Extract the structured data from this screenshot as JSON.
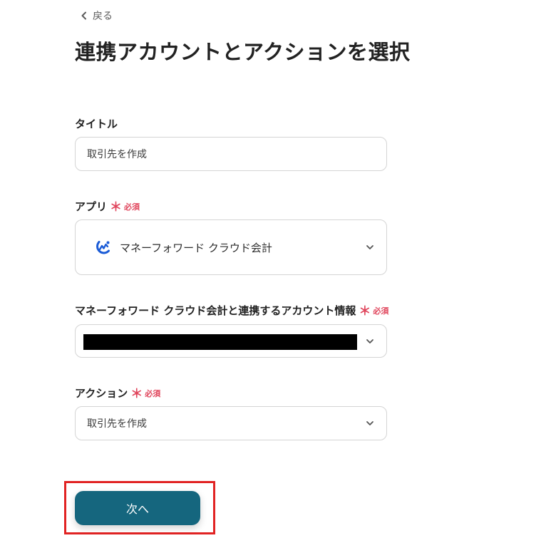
{
  "header": {
    "back_label": "戻る",
    "title": "連携アカウントとアクションを選択"
  },
  "form": {
    "title_field": {
      "label": "タイトル",
      "value": "取引先を作成"
    },
    "app_field": {
      "label": "アプリ",
      "required_mark": "＊",
      "required_text": "必須",
      "value": "マネーフォワード クラウド会計",
      "logo_icon": "moneyforward-logo-icon",
      "logo_color": "#1a5bd6"
    },
    "account_field": {
      "label": "マネーフォワード クラウド会計と連携するアカウント情報",
      "required_mark": "＊",
      "required_text": "必須"
    },
    "action_field": {
      "label": "アクション",
      "required_mark": "＊",
      "required_text": "必須",
      "value": "取引先を作成"
    }
  },
  "footer": {
    "next_label": "次へ",
    "button_color": "#15667e",
    "highlight_color": "#e12323"
  },
  "colors": {
    "required": "#e0455c",
    "border": "#d4d4d4"
  }
}
